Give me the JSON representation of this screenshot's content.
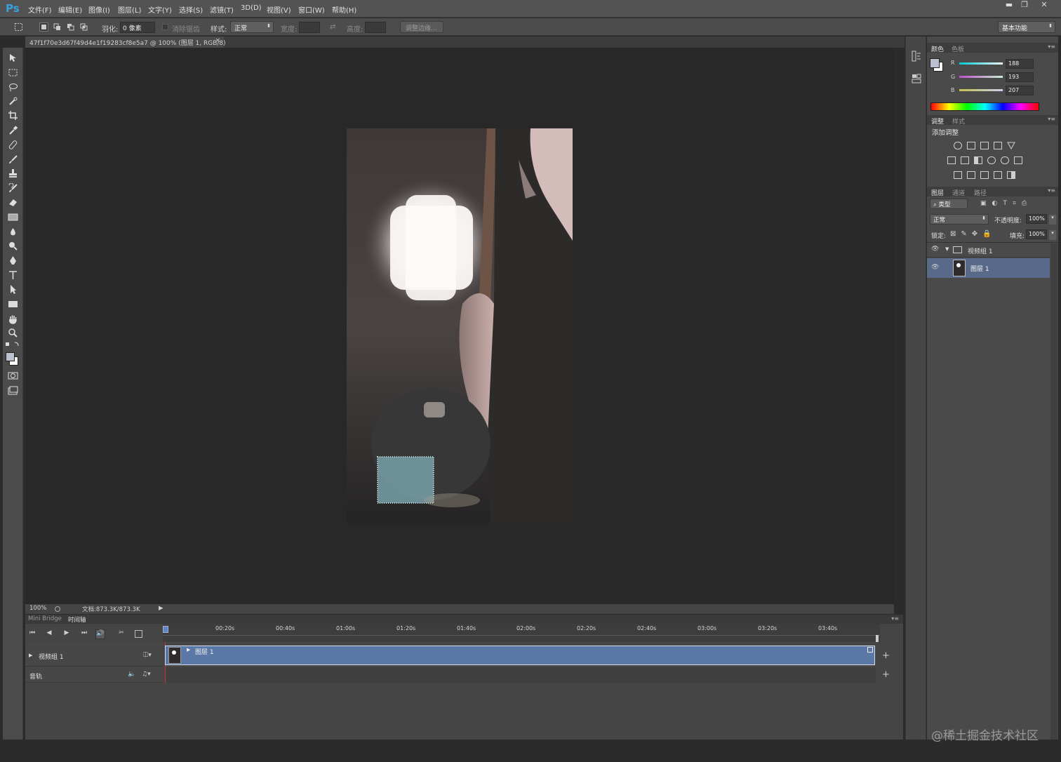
{
  "app": {
    "logo": "Ps"
  },
  "menu": [
    "文件(F)",
    "编辑(E)",
    "图像(I)",
    "图层(L)",
    "文字(Y)",
    "选择(S)",
    "滤镜(T)",
    "3D(D)",
    "视图(V)",
    "窗口(W)",
    "帮助(H)"
  ],
  "window_controls": {
    "minimize": "▬",
    "restore": "❐",
    "close": "✕"
  },
  "options": {
    "feather_label": "羽化:",
    "feather_value": "0 像素",
    "antialias_label": "消除锯齿",
    "style_label": "样式:",
    "style_value": "正常",
    "width_label": "宽度:",
    "height_label": "高度:",
    "refine_button": "调整边缘...",
    "workspace": "基本功能"
  },
  "document_tab": {
    "title": "47f1f70e3d67f49d4e1f19283cf8e5a7 @ 100% (图层 1, RGB/8)",
    "close": "×"
  },
  "status": {
    "zoom": "100%",
    "doc": "文档:873.3K/873.3K"
  },
  "color_panel": {
    "tabs": [
      "颜色",
      "色板"
    ],
    "r_label": "R",
    "g_label": "G",
    "b_label": "B",
    "r": "188",
    "g": "193",
    "b": "207",
    "fg_color": "#bcc1cf"
  },
  "adjust_panel": {
    "tabs": [
      "调整",
      "样式"
    ],
    "title": "添加调整"
  },
  "layers_panel": {
    "tabs": [
      "图层",
      "通道",
      "路径"
    ],
    "filter": "类型",
    "blend_mode": "正常",
    "opacity_label": "不透明度:",
    "opacity": "100%",
    "lock_label": "锁定:",
    "fill_label": "填充:",
    "fill": "100%",
    "group_name": "视频组 1",
    "layer_name": "图层 1"
  },
  "timeline": {
    "tabs": [
      "Mini Bridge",
      "时间轴"
    ],
    "ticks": [
      "00:20s",
      "00:40s",
      "01:00s",
      "01:20s",
      "01:40s",
      "02:00s",
      "02:20s",
      "02:40s",
      "03:00s",
      "03:20s",
      "03:40s"
    ],
    "track_name": "视频组 1",
    "audio_name": "音轨",
    "clip_name": "图层 1"
  },
  "watermark": "@稀土掘金技术社区"
}
